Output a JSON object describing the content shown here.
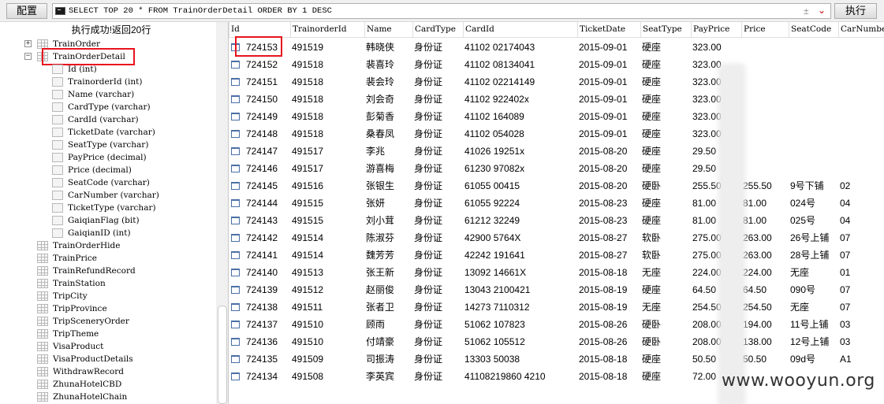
{
  "toolbar": {
    "config_label": "配置",
    "sql": "SELECT TOP 20 * FROM TrainOrderDetail ORDER BY 1 DESC",
    "stepper_glyph": "±",
    "dropdown_glyph": "⌄",
    "execute_label": "执行"
  },
  "status": {
    "message": "执行成功!返回20行"
  },
  "tree": {
    "nodes": [
      {
        "label": "TrainOrder",
        "kind": "table",
        "expander": "+"
      },
      {
        "label": "TrainOrderDetail",
        "kind": "table",
        "expander": "−",
        "selected": true
      },
      {
        "label": "Id (int)",
        "kind": "column"
      },
      {
        "label": "TrainorderId (int)",
        "kind": "column"
      },
      {
        "label": "Name (varchar)",
        "kind": "column"
      },
      {
        "label": "CardType (varchar)",
        "kind": "column"
      },
      {
        "label": "CardId (varchar)",
        "kind": "column"
      },
      {
        "label": "TicketDate (varchar)",
        "kind": "column"
      },
      {
        "label": "SeatType (varchar)",
        "kind": "column"
      },
      {
        "label": "PayPrice (decimal)",
        "kind": "column"
      },
      {
        "label": "Price (decimal)",
        "kind": "column"
      },
      {
        "label": "SeatCode (varchar)",
        "kind": "column"
      },
      {
        "label": "CarNumber (varchar)",
        "kind": "column"
      },
      {
        "label": "TicketType (varchar)",
        "kind": "column"
      },
      {
        "label": "GaiqianFlag (bit)",
        "kind": "column"
      },
      {
        "label": "GaiqianID (int)",
        "kind": "column"
      },
      {
        "label": "TrainOrderHide",
        "kind": "table"
      },
      {
        "label": "TrainPrice",
        "kind": "table"
      },
      {
        "label": "TrainRefundRecord",
        "kind": "table"
      },
      {
        "label": "TrainStation",
        "kind": "table"
      },
      {
        "label": "TripCity",
        "kind": "table"
      },
      {
        "label": "TripProvince",
        "kind": "table"
      },
      {
        "label": "TripSceneryOrder",
        "kind": "table"
      },
      {
        "label": "TripTheme",
        "kind": "table"
      },
      {
        "label": "VisaProduct",
        "kind": "table"
      },
      {
        "label": "VisaProductDetails",
        "kind": "table"
      },
      {
        "label": "WithdrawRecord",
        "kind": "table"
      },
      {
        "label": "ZhunaHotelCBD",
        "kind": "table"
      },
      {
        "label": "ZhunaHotelChain",
        "kind": "table"
      }
    ]
  },
  "grid": {
    "columns": [
      "Id",
      "TrainorderId",
      "Name",
      "CardType",
      "CardId",
      "TicketDate",
      "SeatType",
      "PayPrice",
      "Price",
      "SeatCode",
      "CarNumber"
    ],
    "rows": [
      [
        "724153",
        "491519",
        "韩晓侠",
        "身份证",
        "41102        02174043",
        "2015-09-01",
        "硬座",
        "323.00",
        "",
        "",
        ""
      ],
      [
        "724152",
        "491518",
        "裴喜玲",
        "身份证",
        "41102        08134041",
        "2015-09-01",
        "硬座",
        "323.00",
        "",
        "",
        ""
      ],
      [
        "724151",
        "491518",
        "裴会玲",
        "身份证",
        "41102        02214149",
        "2015-09-01",
        "硬座",
        "323.00",
        "",
        "",
        ""
      ],
      [
        "724150",
        "491518",
        "刘会奇",
        "身份证",
        "41102        922402x",
        "2015-09-01",
        "硬座",
        "323.00",
        "",
        "",
        ""
      ],
      [
        "724149",
        "491518",
        "彭菊香",
        "身份证",
        "41102        164089",
        "2015-09-01",
        "硬座",
        "323.00",
        "",
        "",
        ""
      ],
      [
        "724148",
        "491518",
        "桑春凤",
        "身份证",
        "41102        054028",
        "2015-09-01",
        "硬座",
        "323.00",
        "",
        "",
        ""
      ],
      [
        "724147",
        "491517",
        "李兆",
        "身份证",
        "41026        19251x",
        "2015-08-20",
        "硬座",
        "29.50",
        "",
        "",
        ""
      ],
      [
        "724146",
        "491517",
        "游喜梅",
        "身份证",
        "61230        97082x",
        "2015-08-20",
        "硬座",
        "29.50",
        "",
        "",
        ""
      ],
      [
        "724145",
        "491516",
        "张银生",
        "身份证",
        "61055        00415",
        "2015-08-20",
        "硬卧",
        "255.50",
        "255.50",
        "9号下铺",
        "02"
      ],
      [
        "724144",
        "491515",
        "张妍",
        "身份证",
        "61055        92224",
        "2015-08-23",
        "硬座",
        "81.00",
        "81.00",
        "024号",
        "04"
      ],
      [
        "724143",
        "491515",
        "刘小茸",
        "身份证",
        "61212        32249",
        "2015-08-23",
        "硬座",
        "81.00",
        "81.00",
        "025号",
        "04"
      ],
      [
        "724142",
        "491514",
        "陈淑芬",
        "身份证",
        "42900        5764X",
        "2015-08-27",
        "软卧",
        "275.00",
        "263.00",
        "26号上铺",
        "07"
      ],
      [
        "724141",
        "491514",
        "魏芳芳",
        "身份证",
        "42242        191641",
        "2015-08-27",
        "软卧",
        "275.00",
        "263.00",
        "28号上铺",
        "07"
      ],
      [
        "724140",
        "491513",
        "张王新",
        "身份证",
        "13092        14661X",
        "2015-08-18",
        "无座",
        "224.00",
        "224.00",
        "无座",
        "01"
      ],
      [
        "724139",
        "491512",
        "赵丽俊",
        "身份证",
        "13043        2100421",
        "2015-08-19",
        "硬座",
        "64.50",
        "64.50",
        "090号",
        "07"
      ],
      [
        "724138",
        "491511",
        "张者卫",
        "身份证",
        "14273        7110312",
        "2015-08-19",
        "无座",
        "254.50",
        "254.50",
        "无座",
        "07"
      ],
      [
        "724137",
        "491510",
        "顾雨",
        "身份证",
        "51062        107823",
        "2015-08-26",
        "硬卧",
        "208.00",
        "194.00",
        "11号上铺",
        "03"
      ],
      [
        "724136",
        "491510",
        "付靖豪",
        "身份证",
        "51062        105512",
        "2015-08-26",
        "硬卧",
        "208.00",
        "138.00",
        "12号上铺",
        "03"
      ],
      [
        "724135",
        "491509",
        "司振涛",
        "身份证",
        "13303        50038",
        "2015-08-18",
        "硬座",
        "50.50",
        "50.50",
        "09d号",
        "A1"
      ],
      [
        "724134",
        "491508",
        "李英宾",
        "身份证",
        "41108219860    4210",
        "2015-08-18",
        "硬座",
        "72.00",
        "",
        "",
        ""
      ]
    ]
  },
  "watermark": "www.wooyun.org"
}
